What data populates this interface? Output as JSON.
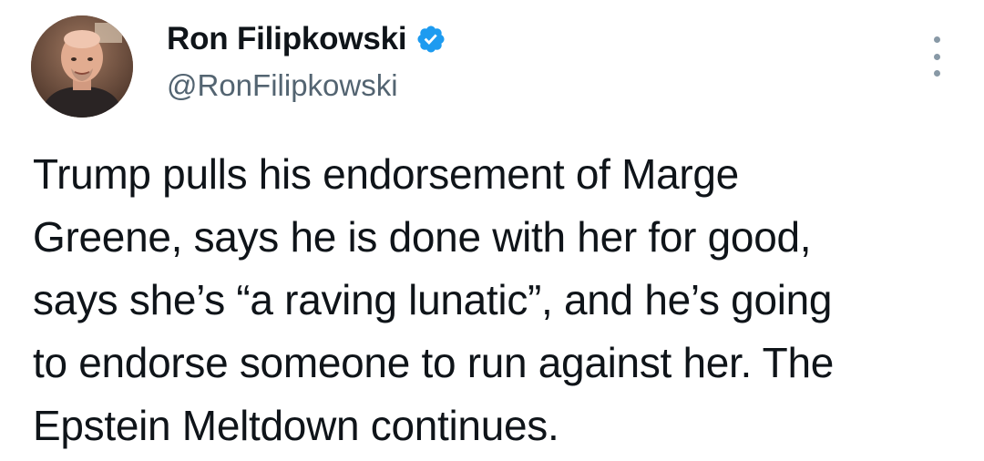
{
  "author": {
    "display_name": "Ron Filipkowski",
    "handle": "@RonFilipkowski",
    "verified_icon": "verified-badge-icon",
    "avatar_icon": "profile-photo"
  },
  "menu": {
    "icon": "more-options-icon"
  },
  "tweet": {
    "line1": "Trump pulls his endorsement of Marge",
    "line2": "Greene, says he is done with her for good,",
    "line3": "says she’s “a raving lunatic”, and he’s going",
    "line4": "to endorse someone to run against her. The",
    "line5": "Epstein Meltdown continues."
  },
  "colors": {
    "text": "#0f1419",
    "handle": "#536471",
    "verified": "#1d9bf0",
    "background": "#ffffff"
  }
}
